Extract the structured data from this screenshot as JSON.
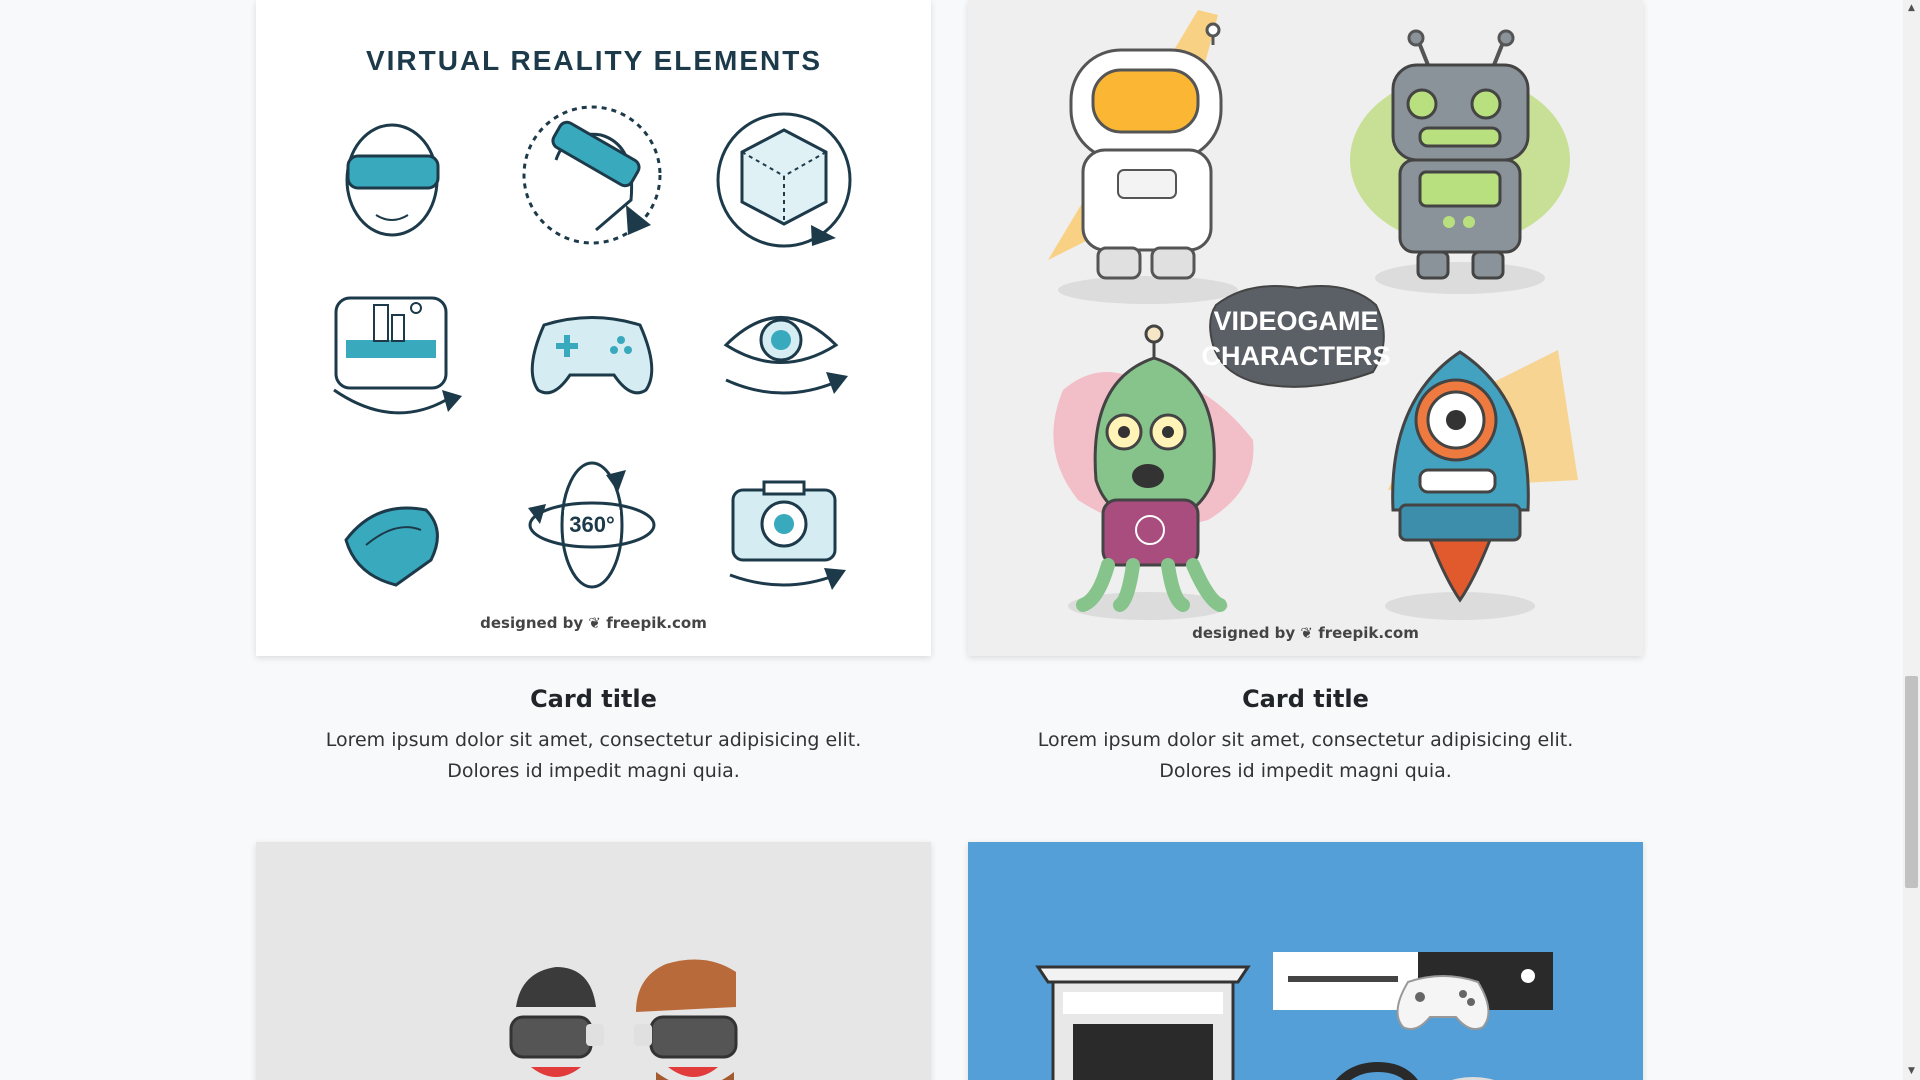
{
  "cards": [
    {
      "title": "Card title",
      "text": "Lorem ipsum dolor sit amet, consectetur adipisicing elit. Dolores id impedit magni quia.",
      "image": {
        "heading": "VIRTUAL REALITY ELEMENTS",
        "credit": "designed by ❦ freepik.com",
        "label_360": "360°"
      }
    },
    {
      "title": "Card title",
      "text": "Lorem ipsum dolor sit amet, consectetur adipisicing elit. Dolores id impedit magni quia.",
      "image": {
        "badge_line1": "VIDEOGAME",
        "badge_line2": "CHARACTERS",
        "credit": "designed by ❦ freepik.com"
      }
    },
    {
      "image": {}
    },
    {
      "image": {}
    }
  ],
  "scrollbar": {
    "up_icon": "triangle-up-icon",
    "down_icon": "triangle-down-icon",
    "up_glyph": "▲",
    "down_glyph": "▼"
  },
  "colors": {
    "page_bg": "#f8f9fa",
    "teal": "#39a9be",
    "dark_navy": "#1c3a4a",
    "blue_card": "#549fd8",
    "grey_card": "#efefef"
  }
}
